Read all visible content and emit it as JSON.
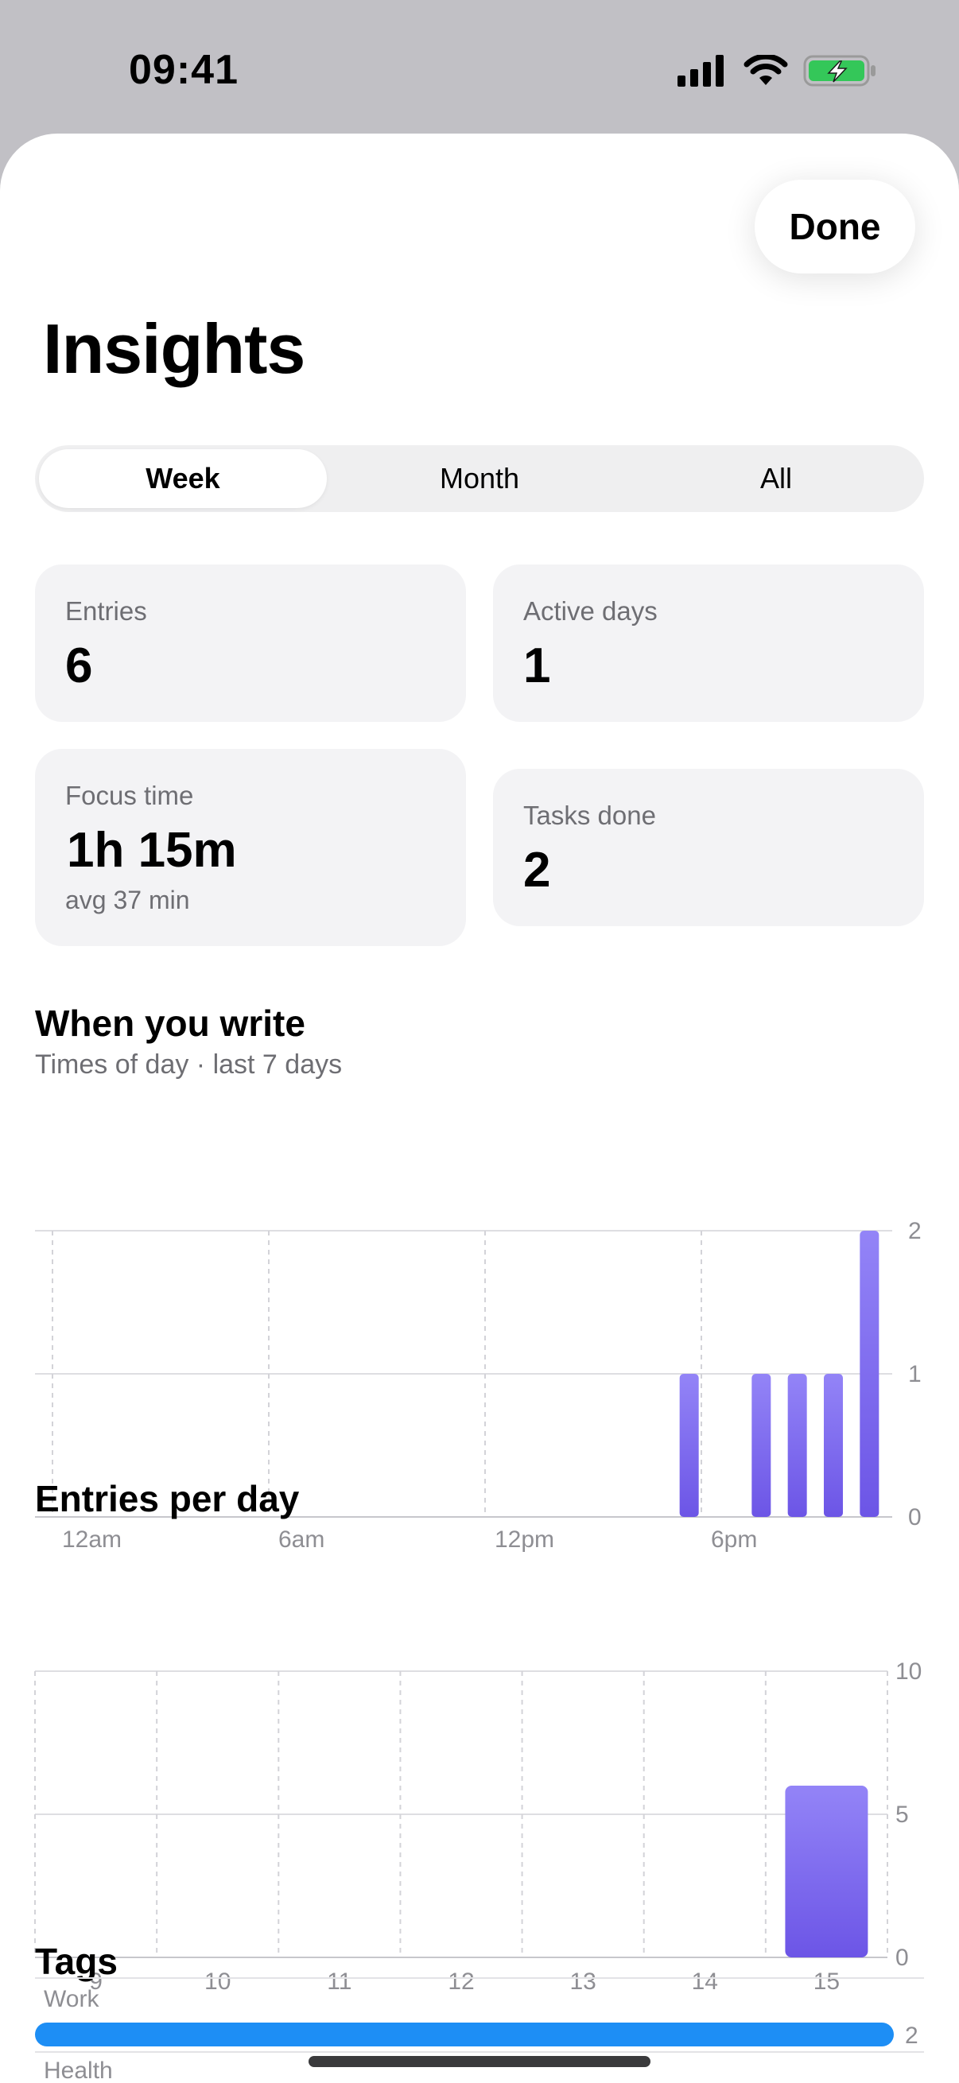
{
  "status_bar": {
    "time": "09:41",
    "icons": [
      "signal-icon",
      "wifi-icon",
      "battery-charging-icon"
    ],
    "battery_color": "#34c759"
  },
  "sheet": {
    "done_label": "Done",
    "title": "Insights",
    "segments": [
      "Week",
      "Month",
      "All"
    ],
    "selected_segment": "Week"
  },
  "stats": {
    "entries": {
      "label": "Entries",
      "value": "6"
    },
    "active_days": {
      "label": "Active days",
      "value": "1"
    },
    "focus_time": {
      "label": "Focus time",
      "value": "1h 15m",
      "sub": "avg 37 min"
    },
    "tasks_done": {
      "label": "Tasks done",
      "value": "2"
    }
  },
  "accent_color": "#7c6cf0",
  "chart_data": [
    {
      "type": "bar",
      "title": "When you write",
      "subtitle": "Times of day · last 7 days",
      "x_tick_labels": [
        "12am",
        "6am",
        "12pm",
        "6pm"
      ],
      "x_unit": "hour",
      "x": [
        17,
        19,
        20,
        21,
        22
      ],
      "values": [
        1,
        1,
        1,
        1,
        2
      ],
      "ylim": [
        0,
        2
      ],
      "y_ticks": [
        0,
        1,
        2
      ],
      "xlim": [
        0,
        24
      ],
      "grid": true,
      "axis_side": "right"
    },
    {
      "type": "bar",
      "title": "Entries per day",
      "categories": [
        "9",
        "10",
        "11",
        "12",
        "13",
        "14",
        "15"
      ],
      "values": [
        0,
        0,
        0,
        0,
        0,
        0,
        6
      ],
      "ylim": [
        0,
        10
      ],
      "y_ticks": [
        0,
        5,
        10
      ],
      "grid": true,
      "axis_side": "right"
    }
  ],
  "tags": {
    "title": "Tags",
    "items": [
      {
        "name": "Work",
        "count": "2",
        "fraction": 1.0
      },
      {
        "name": "Health",
        "count": "",
        "fraction": 0
      }
    ],
    "bar_color": "#1d8ef5"
  }
}
